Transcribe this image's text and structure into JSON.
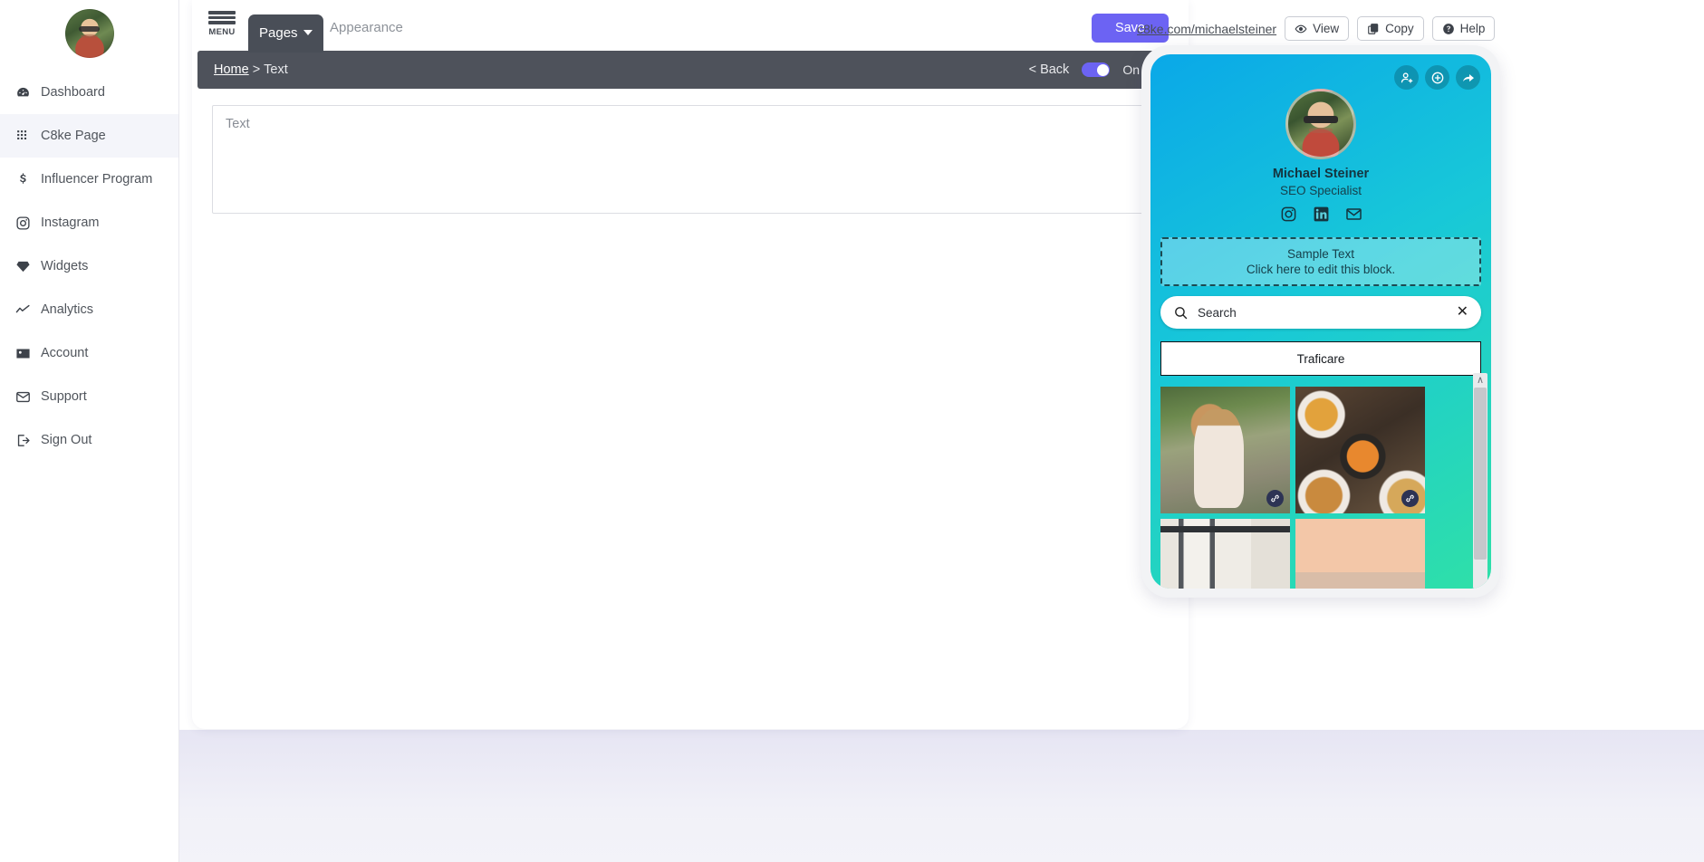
{
  "sidebar": {
    "avatar_name": "user-avatar",
    "items": [
      {
        "label": "Dashboard",
        "icon": "dashboard-icon"
      },
      {
        "label": "C8ke Page",
        "icon": "grid-icon"
      },
      {
        "label": "Influencer Program",
        "icon": "dollar-icon"
      },
      {
        "label": "Instagram",
        "icon": "instagram-icon"
      },
      {
        "label": "Widgets",
        "icon": "gem-icon"
      },
      {
        "label": "Analytics",
        "icon": "chart-line-icon"
      },
      {
        "label": "Account",
        "icon": "id-card-icon"
      },
      {
        "label": "Support",
        "icon": "envelope-icon"
      },
      {
        "label": "Sign Out",
        "icon": "sign-out-icon"
      }
    ]
  },
  "toolbar": {
    "menu_label": "MENU",
    "tab_pages": "Pages",
    "tab_appearance": "Appearance",
    "save_label": "Save"
  },
  "breadcrumb": {
    "home": "Home",
    "separator": ">",
    "current": "Text",
    "back_label": "< Back",
    "toggle_state": "On",
    "toggle_on": true,
    "toggle_color": "#6c63f3",
    "delete_icon": "trash-icon"
  },
  "editor": {
    "placeholder": "Text",
    "value": ""
  },
  "preview_header": {
    "url": "c8ke.com/michaelsteiner",
    "buttons": [
      {
        "label": "View",
        "icon": "eye-icon"
      },
      {
        "label": "Copy",
        "icon": "copy-icon"
      },
      {
        "label": "Help",
        "icon": "question-circle-icon"
      }
    ]
  },
  "phone": {
    "actions": [
      {
        "icon": "add-person-icon"
      },
      {
        "icon": "plus-circle-icon"
      },
      {
        "icon": "share-icon"
      }
    ],
    "profile": {
      "name": "Michael Steiner",
      "role": "SEO Specialist",
      "socials": [
        {
          "icon": "instagram-icon"
        },
        {
          "icon": "linkedin-icon"
        },
        {
          "icon": "email-icon"
        }
      ]
    },
    "sample_block": {
      "line1": "Sample Text",
      "line2": "Click here to edit this block."
    },
    "search": {
      "value": "Search",
      "icon": "search-icon",
      "clear_icon": "close-icon"
    },
    "link_button": "Traficare",
    "gallery": [
      {
        "alt": "woman-with-handbag",
        "style": "p-fashion",
        "badge": "link-icon"
      },
      {
        "alt": "food-bowls-overhead",
        "style": "p-food",
        "badge": "link-icon"
      },
      {
        "alt": "interior-curtains-window",
        "style": "p-interior",
        "badge": ""
      },
      {
        "alt": "cruise-ship-city-skyline",
        "style": "p-city",
        "badge": ""
      }
    ],
    "scrollbar": {
      "arrow": "∧"
    }
  },
  "colors": {
    "accent_purple": "#6c63f3",
    "toolbar_dark": "#4e525b",
    "phone_gradient_start": "#0aa8e8",
    "phone_gradient_end": "#2fe0a8"
  }
}
